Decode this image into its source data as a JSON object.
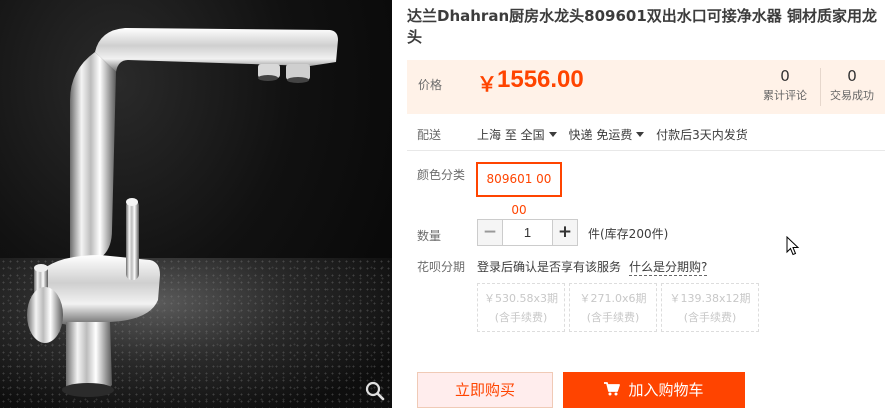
{
  "product": {
    "title": "达兰Dhahran厨房水龙头809601双出水口可接净水器 铜材质家用龙头",
    "image_zoom_icon": "magnifier-icon"
  },
  "price": {
    "label": "价格",
    "currency": "￥",
    "amount": "1556.00",
    "color": "#ff4400"
  },
  "stats": {
    "reviews_count": "0",
    "reviews_label": "累计评论",
    "sales_count": "0",
    "sales_label": "交易成功"
  },
  "shipping": {
    "label": "配送",
    "from": "上海 至",
    "to": "全国",
    "method": "快递 免运费",
    "dispatch": "付款后3天内发货"
  },
  "color_category": {
    "label": "颜色分类",
    "selected": "809601 00 00"
  },
  "quantity": {
    "label": "数量",
    "minus": "−",
    "value": "1",
    "plus": "+",
    "stock": "件(库存200件)"
  },
  "huabei": {
    "label": "花呗分期",
    "text": "登录后确认是否享有该服务",
    "link": "什么是分期购?",
    "plans": [
      {
        "amount": "￥530.58x3期",
        "fee": "(含手续费)"
      },
      {
        "amount": "￥271.0x6期",
        "fee": "(含手续费)"
      },
      {
        "amount": "￥139.38x12期",
        "fee": "(含手续费)"
      }
    ]
  },
  "actions": {
    "buy_now": "立即购买",
    "add_to_cart": "加入购物车",
    "cart_icon": "shopping-cart-icon"
  },
  "colors": {
    "accent": "#ff4400",
    "price_bg": "#fff2e8",
    "buy_now_bg": "#ffeded"
  }
}
